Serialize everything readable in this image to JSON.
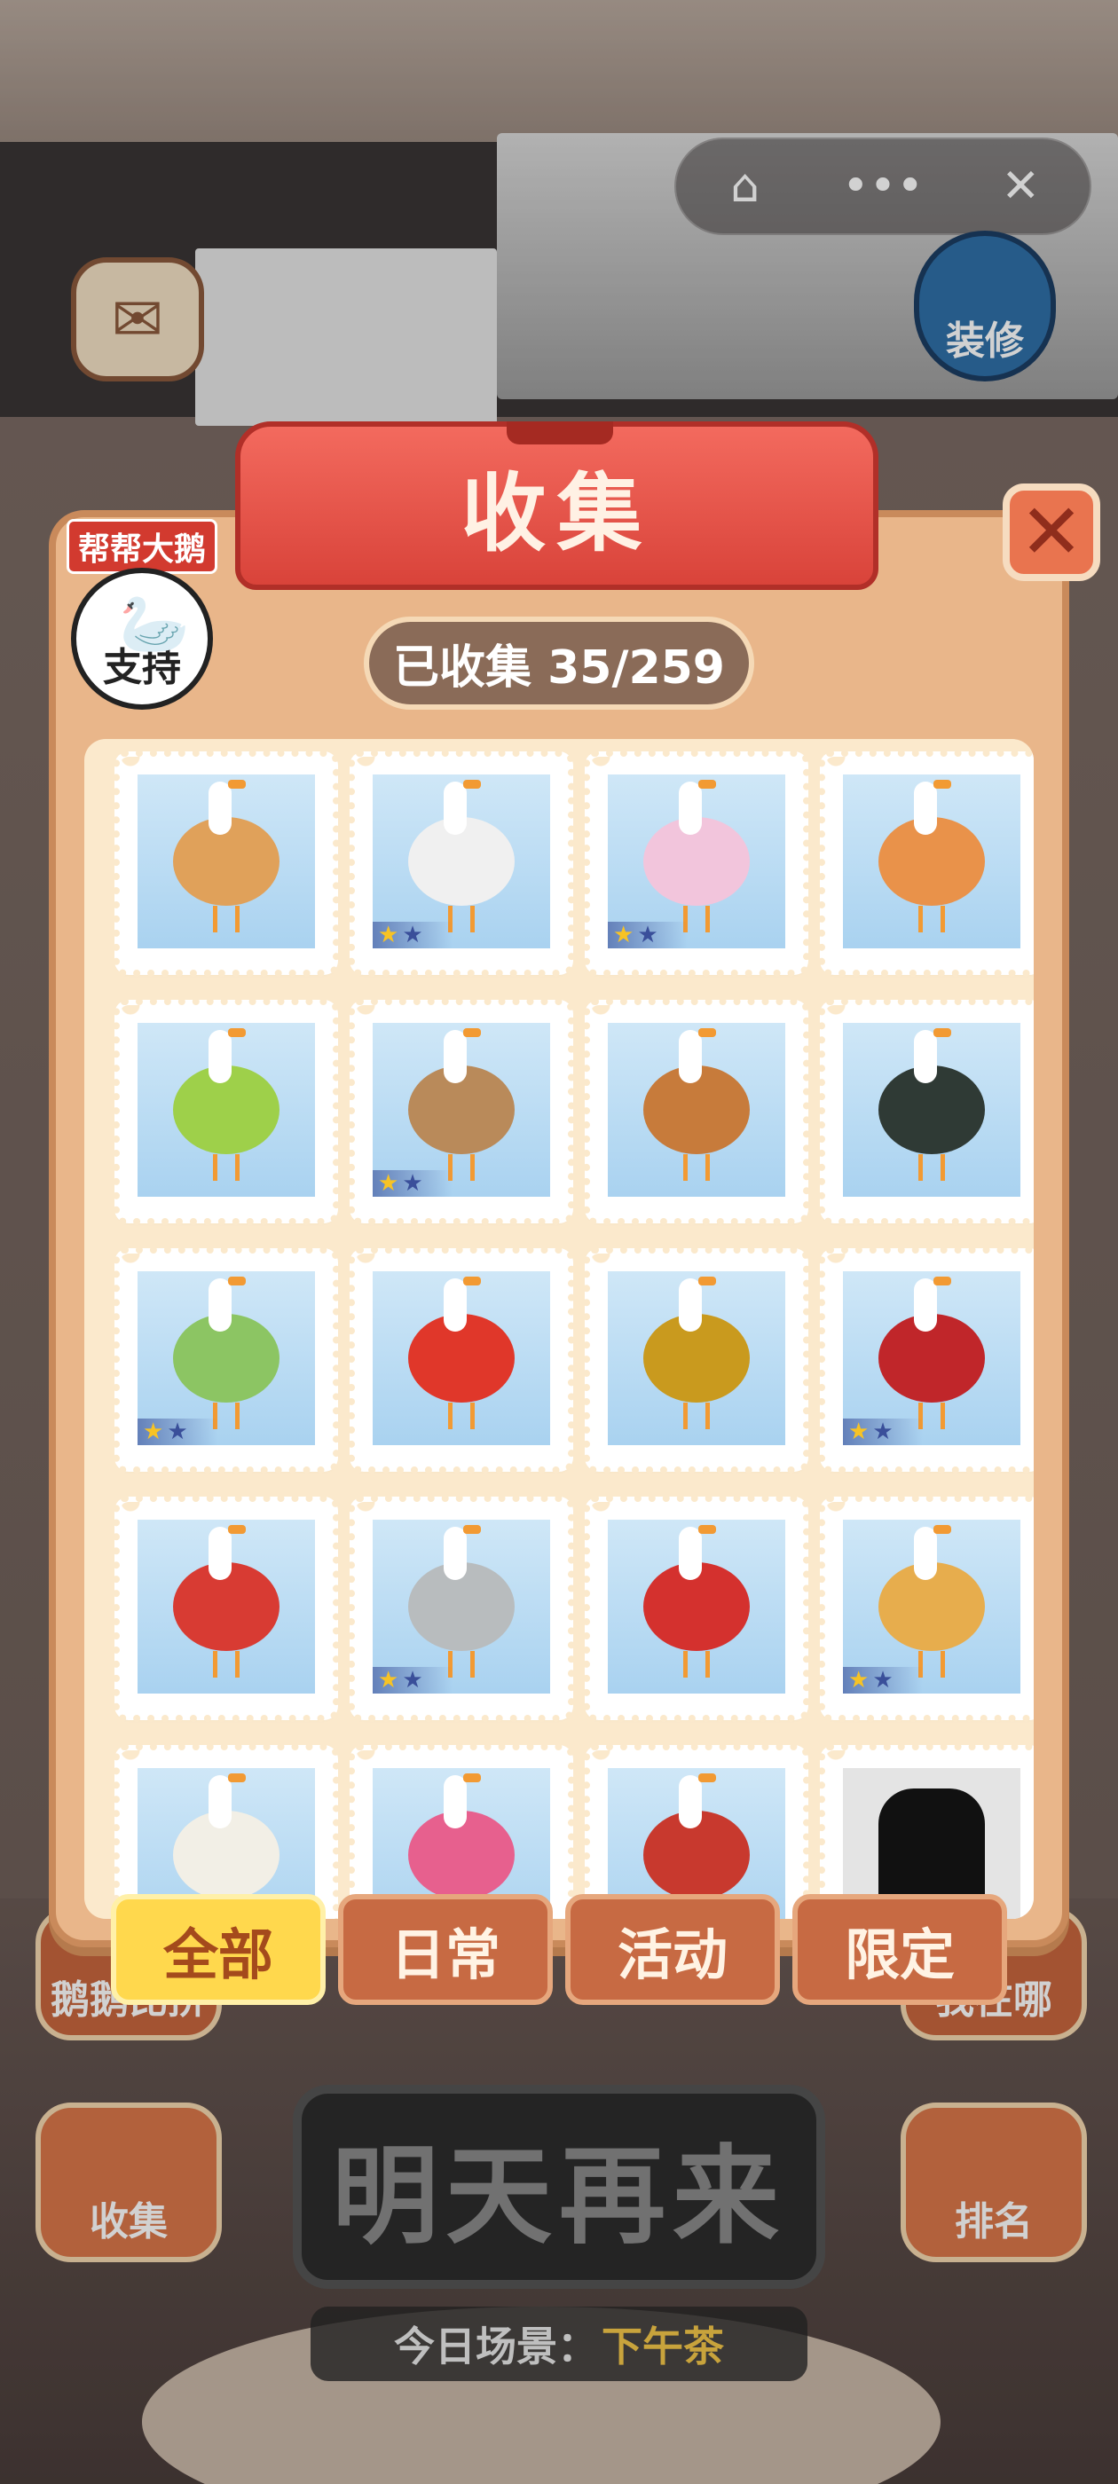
{
  "capsule": {
    "home_icon": "⌂",
    "more_icon": "•••",
    "close_icon": "✕"
  },
  "background": {
    "renovate_label": "装修",
    "left_hidden_label": "鹅鹅比拼",
    "right_hidden_label": "我在哪",
    "collect_label": "收集",
    "rank_label": "排名",
    "come_tomorrow_label": "明天再来",
    "scene_label": "今日场景：",
    "scene_value": "下午茶"
  },
  "panel": {
    "title": "收集",
    "support_flag": "帮帮大鹅",
    "support_label": "支持",
    "counter": "已收集 35/259",
    "close_icon": "✕"
  },
  "tabs": [
    {
      "label": "全部",
      "active": true
    },
    {
      "label": "日常",
      "active": false
    },
    {
      "label": "活动",
      "active": false
    },
    {
      "label": "限定",
      "active": false
    }
  ],
  "stamps": [
    {
      "item": "dumpling-goose",
      "color": "#e0a15a",
      "stars": 0
    },
    {
      "item": "teapot-goose",
      "color": "#f0f0f0",
      "stars": 2
    },
    {
      "item": "cup-goose",
      "color": "#f2c5dc",
      "stars": 2
    },
    {
      "item": "sesame-ball-goose",
      "color": "#e9924a",
      "stars": 0
    },
    {
      "item": "lime-goose",
      "color": "#9ed04a",
      "stars": 0
    },
    {
      "item": "potato-goose",
      "color": "#b98a5a",
      "stars": 2
    },
    {
      "item": "cake-goose",
      "color": "#c77b3b",
      "stars": 0
    },
    {
      "item": "rice-dumpling-goose",
      "color": "#2f3a35",
      "stars": 0
    },
    {
      "item": "cabbage-goose",
      "color": "#8cc563",
      "stars": 2
    },
    {
      "item": "strawberry-goose",
      "color": "#e0372a",
      "stars": 0
    },
    {
      "item": "gold-ingot-goose",
      "color": "#c99a1e",
      "stars": 0
    },
    {
      "item": "red-bean-goose",
      "color": "#c0262a",
      "stars": 2
    },
    {
      "item": "tanghulu-goose",
      "color": "#d83b33",
      "stars": 0
    },
    {
      "item": "grey-goose",
      "color": "#b8bcbe",
      "stars": 2
    },
    {
      "item": "floral-jacket-goose",
      "color": "#d4312e",
      "stars": 0
    },
    {
      "item": "egg-tart-goose",
      "color": "#e7ad4d",
      "stars": 2
    },
    {
      "item": "milk-bottle-goose",
      "color": "#f2efe6",
      "stars": 2
    },
    {
      "item": "donut-goose",
      "color": "#e7608e",
      "stars": 2
    },
    {
      "item": "noodle-cup-goose",
      "color": "#c8392e",
      "stars": 2
    },
    {
      "item": "locked-silhouette",
      "color": "#111111",
      "stars": 0,
      "locked": true
    }
  ]
}
